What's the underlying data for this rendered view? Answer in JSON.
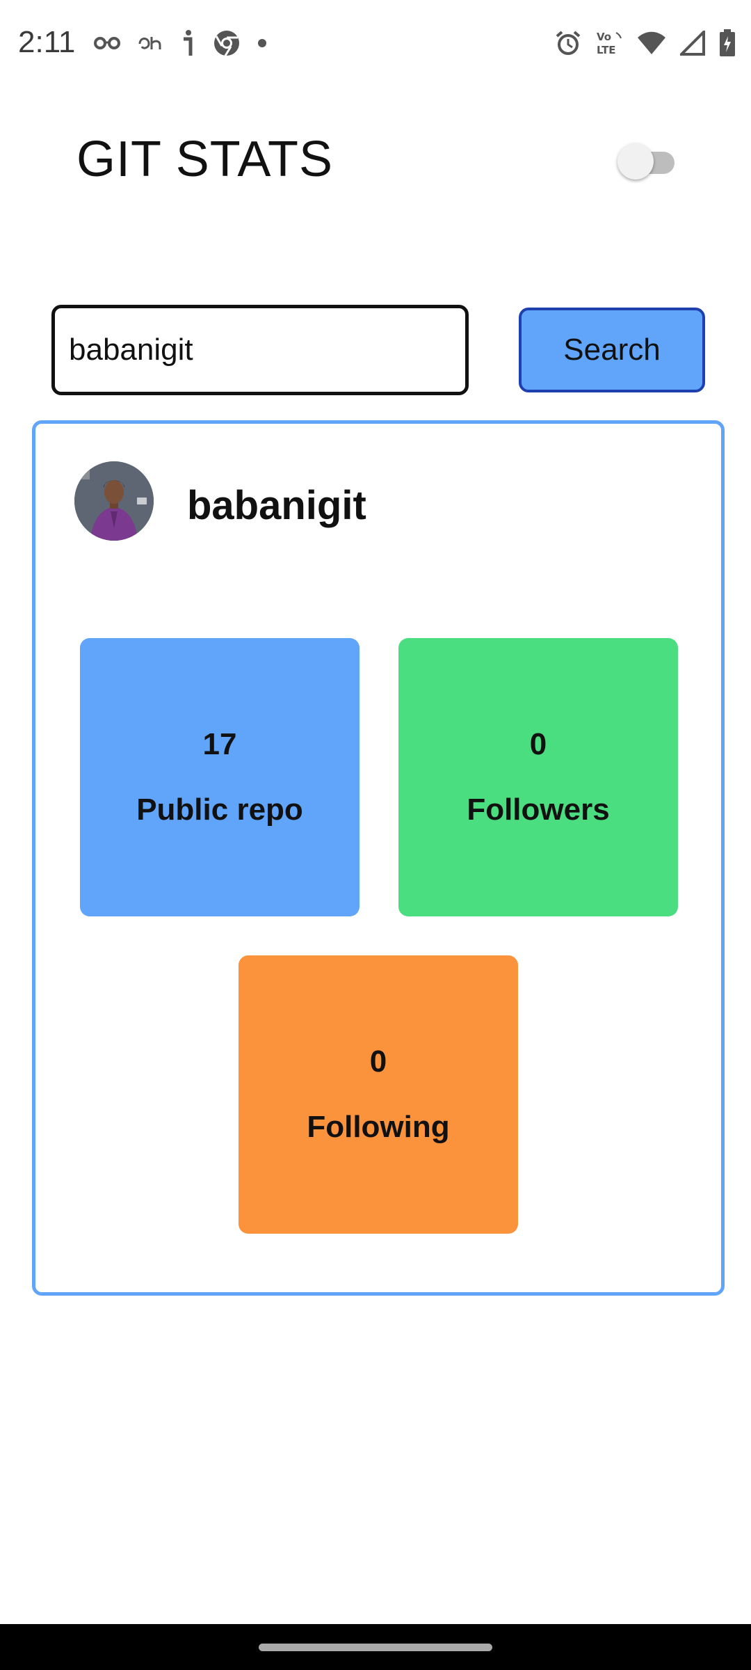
{
  "status_bar": {
    "time": "2:11",
    "left_icons": [
      "glasses-icon",
      "app-notification-icon",
      "info-icon",
      "chrome-icon",
      "dot-icon"
    ],
    "right_icons": [
      "alarm-icon",
      "volte-icon",
      "wifi-icon",
      "signal-icon",
      "battery-icon"
    ],
    "volte_label": "Vo LTE"
  },
  "header": {
    "title": "GIT STATS",
    "dark_mode_toggle": "off"
  },
  "search": {
    "input_value": "babanigit",
    "button_label": "Search"
  },
  "profile": {
    "username": "babanigit",
    "avatar": "user-avatar-photo",
    "stats": [
      {
        "value": "17",
        "label": "Public repo",
        "color": "#60a5fa"
      },
      {
        "value": "0",
        "label": "Followers",
        "color": "#4ade80"
      },
      {
        "value": "0",
        "label": "Following",
        "color": "#fb923c"
      }
    ]
  },
  "colors": {
    "accent_blue": "#60a5fa",
    "button_border": "#1e40af",
    "green": "#4ade80",
    "orange": "#fb923c"
  }
}
